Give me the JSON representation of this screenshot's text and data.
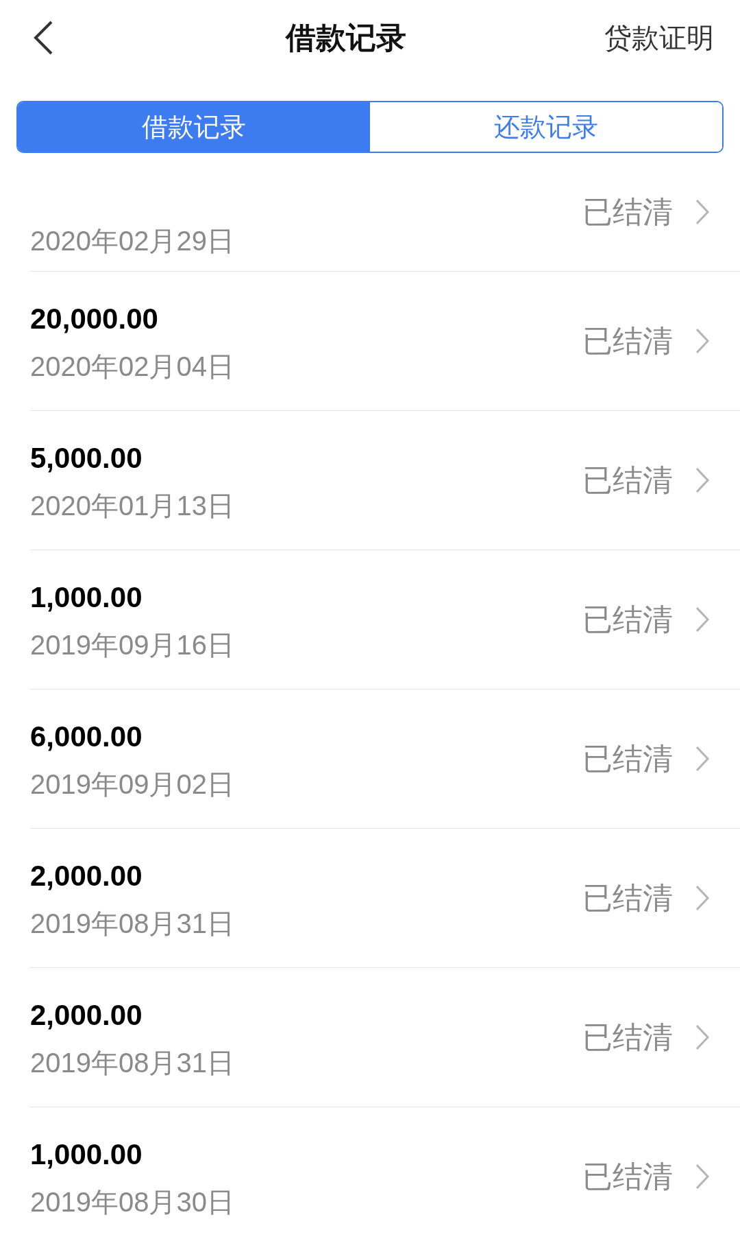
{
  "header": {
    "title": "借款记录",
    "action": "贷款证明"
  },
  "tabs": [
    {
      "label": "借款记录",
      "selected": true
    },
    {
      "label": "还款记录",
      "selected": false
    }
  ],
  "records": [
    {
      "date": "2020年02月29日",
      "status": "已结清"
    },
    {
      "amount": "20,000.00",
      "date": "2020年02月04日",
      "status": "已结清"
    },
    {
      "amount": "5,000.00",
      "date": "2020年01月13日",
      "status": "已结清"
    },
    {
      "amount": "1,000.00",
      "date": "2019年09月16日",
      "status": "已结清"
    },
    {
      "amount": "6,000.00",
      "date": "2019年09月02日",
      "status": "已结清"
    },
    {
      "amount": "2,000.00",
      "date": "2019年08月31日",
      "status": "已结清"
    },
    {
      "amount": "2,000.00",
      "date": "2019年08月31日",
      "status": "已结清"
    },
    {
      "amount": "1,000.00",
      "date": "2019年08月30日",
      "status": "已结清"
    }
  ]
}
